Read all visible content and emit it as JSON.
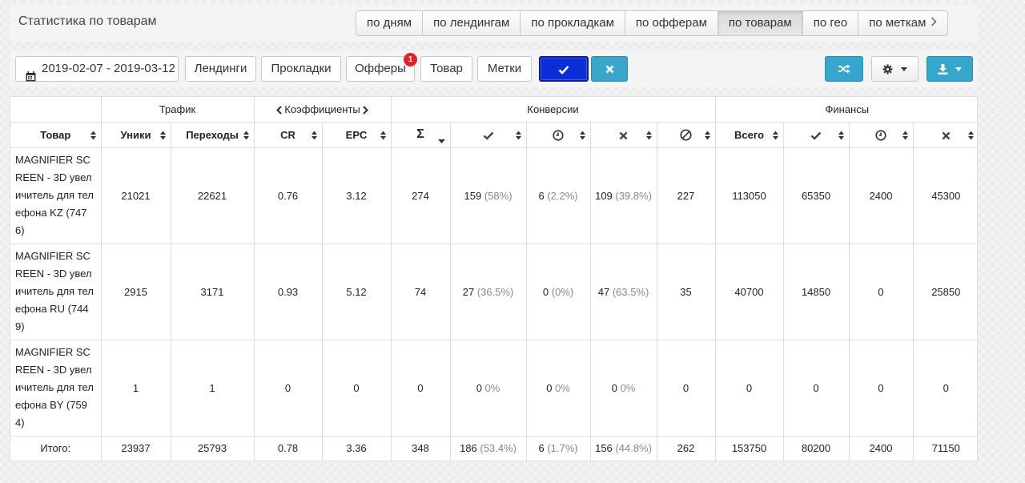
{
  "header": {
    "title": "Статистика по товарам",
    "tabs": [
      {
        "label": "по дням",
        "active": false
      },
      {
        "label": "по лендингам",
        "active": false
      },
      {
        "label": "по прокладкам",
        "active": false
      },
      {
        "label": "по офферам",
        "active": false
      },
      {
        "label": "по товарам",
        "active": true
      },
      {
        "label": "по гео",
        "active": false
      },
      {
        "label": "по меткам",
        "active": false,
        "icon": "chevron-right-icon"
      }
    ]
  },
  "filters": {
    "date_range": "2019-02-07 - 2019-03-12",
    "landings": "Лендинги",
    "prokladki": "Прокладки",
    "offers": "Офферы",
    "offers_badge": "1",
    "tovar": "Товар",
    "metki": "Метки",
    "apply_icon": "check-icon",
    "clear_icon": "times-icon",
    "shuffle_icon": "random-icon",
    "settings_icon": "gear-icon",
    "export_icon": "download-icon"
  },
  "colors": {
    "apply": "#0a2fd6",
    "info": "#35a7cc",
    "badge": "#e8202a"
  },
  "table": {
    "groups": {
      "traffic": "Трафик",
      "coefficients": "Коэффициенты",
      "conversions": "Конверсии",
      "finances": "Финансы"
    },
    "columns": {
      "product": "Товар",
      "uniques": "Уники",
      "clicks": "Переходы",
      "cr": "CR",
      "epc": "EPC",
      "sum": "Σ",
      "fin_total": "Всего"
    },
    "rows": [
      {
        "product": "MAGNIFIER SCREEN - 3D увеличитель для телефона KZ (7476)",
        "uniques": "21021",
        "clicks": "22621",
        "cr": "0.76",
        "epc": "3.12",
        "sum": "274",
        "approved": "159",
        "approved_pct": "(58%)",
        "hold": "6",
        "hold_pct": "(2.2%)",
        "rejected": "109",
        "rejected_pct": "(39.8%)",
        "trash": "227",
        "fin_total": "113050",
        "fin_approved": "65350",
        "fin_hold": "2400",
        "fin_rejected": "45300"
      },
      {
        "product": "MAGNIFIER SCREEN - 3D увеличитель для телефона RU (7449)",
        "uniques": "2915",
        "clicks": "3171",
        "cr": "0.93",
        "epc": "5.12",
        "sum": "74",
        "approved": "27",
        "approved_pct": "(36.5%)",
        "hold": "0",
        "hold_pct": "(0%)",
        "rejected": "47",
        "rejected_pct": "(63.5%)",
        "trash": "35",
        "fin_total": "40700",
        "fin_approved": "14850",
        "fin_hold": "0",
        "fin_rejected": "25850"
      },
      {
        "product": "MAGNIFIER SCREEN - 3D увеличитель для телефона BY (7594)",
        "uniques": "1",
        "clicks": "1",
        "cr": "0",
        "epc": "0",
        "sum": "0",
        "approved": "0",
        "approved_pct": "0%",
        "hold": "0",
        "hold_pct": "0%",
        "rejected": "0",
        "rejected_pct": "0%",
        "trash": "0",
        "fin_total": "0",
        "fin_approved": "0",
        "fin_hold": "0",
        "fin_rejected": "0"
      }
    ],
    "total": {
      "label": "Итого:",
      "uniques": "23937",
      "clicks": "25793",
      "cr": "0.78",
      "epc": "3.36",
      "sum": "348",
      "approved": "186",
      "approved_pct": "(53.4%)",
      "hold": "6",
      "hold_pct": "(1.7%)",
      "rejected": "156",
      "rejected_pct": "(44.8%)",
      "trash": "262",
      "fin_total": "153750",
      "fin_approved": "80200",
      "fin_hold": "2400",
      "fin_rejected": "71150"
    }
  }
}
